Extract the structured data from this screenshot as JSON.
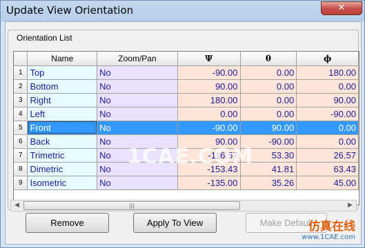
{
  "window": {
    "title": "Update View Orientation",
    "close_label": "✕"
  },
  "group": {
    "label": "Orientation List"
  },
  "table": {
    "headers": [
      "Name",
      "Zoom/Pan",
      "Ψ",
      "θ",
      "ϕ"
    ],
    "rows": [
      {
        "num": "1",
        "name": "Top",
        "zoom": "No",
        "psi": "-90.00",
        "theta": "0.00",
        "phi": "180.00"
      },
      {
        "num": "2",
        "name": "Bottom",
        "zoom": "No",
        "psi": "90.00",
        "theta": "0.00",
        "phi": "0.00"
      },
      {
        "num": "3",
        "name": "Right",
        "zoom": "No",
        "psi": "180.00",
        "theta": "0.00",
        "phi": "90.00"
      },
      {
        "num": "4",
        "name": "Left",
        "zoom": "No",
        "psi": "0.00",
        "theta": "0.00",
        "phi": "-90.00"
      },
      {
        "num": "5",
        "name": "Front",
        "zoom": "No",
        "psi": "-90.00",
        "theta": "90.00",
        "phi": "0.00"
      },
      {
        "num": "6",
        "name": "Back",
        "zoom": "No",
        "psi": "90.00",
        "theta": "-90.00",
        "phi": "0.00"
      },
      {
        "num": "7",
        "name": "Trimetric",
        "zoom": "No",
        "psi": "-116.57",
        "theta": "53.30",
        "phi": "26.57"
      },
      {
        "num": "8",
        "name": "Dimetric",
        "zoom": "No",
        "psi": "-153.43",
        "theta": "41.81",
        "phi": "63.43"
      },
      {
        "num": "9",
        "name": "Isometric",
        "zoom": "No",
        "psi": "-135.00",
        "theta": "35.26",
        "phi": "45.00"
      }
    ],
    "selected_row": "5"
  },
  "scrollbar": {
    "left_arrow": "◀",
    "right_arrow": "▶",
    "thumb_grip": "|||"
  },
  "buttons": {
    "remove": "Remove",
    "apply": "Apply To View",
    "make_default": "Make Default"
  },
  "watermark": {
    "center": "1CAE.COM",
    "bottom_cn": "仿真在线",
    "bottom_url": "www.1CAE.com"
  }
}
